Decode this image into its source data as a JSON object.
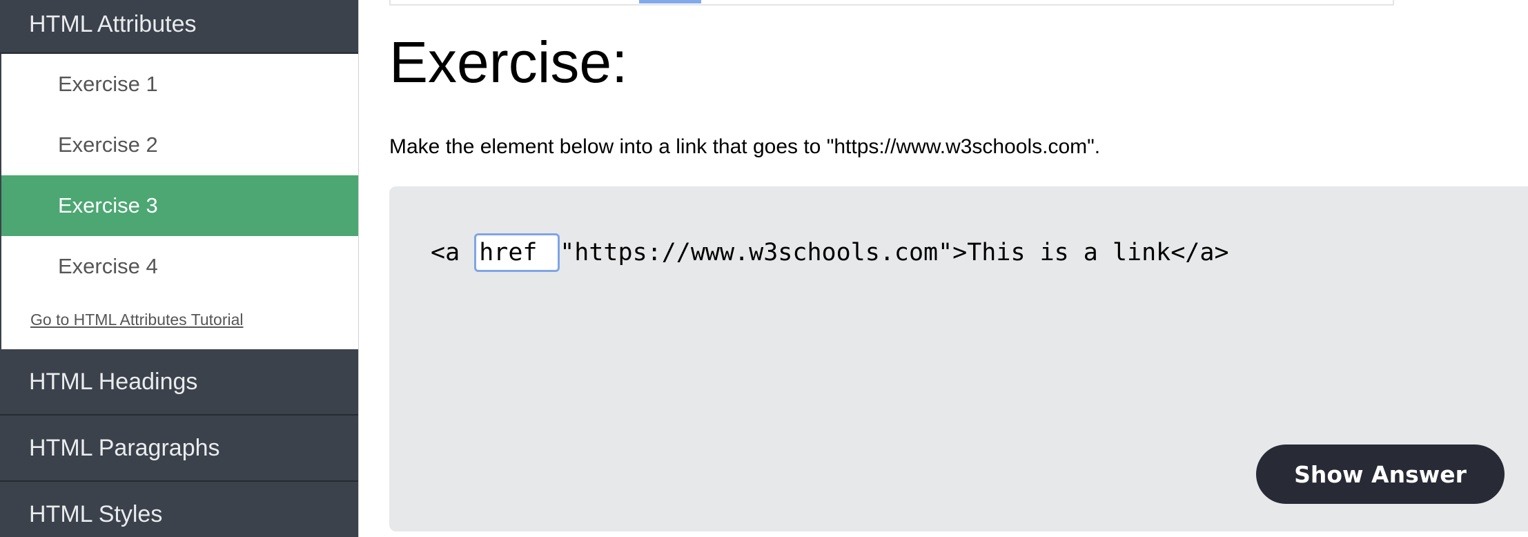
{
  "sidebar": {
    "section_title": "HTML Attributes",
    "items": [
      {
        "label": "Exercise 1",
        "active": false
      },
      {
        "label": "Exercise 2",
        "active": false
      },
      {
        "label": "Exercise 3",
        "active": true
      },
      {
        "label": "Exercise 4",
        "active": false
      }
    ],
    "tutorial_link": "Go to HTML Attributes Tutorial",
    "other_sections": [
      "HTML Headings",
      "HTML Paragraphs",
      "HTML Styles"
    ]
  },
  "main": {
    "title": "Exercise:",
    "instruction": "Make the element below into a link that goes to \"https://www.w3schools.com\".",
    "code": {
      "before": "<a ",
      "input_value": "href ",
      "after": "\"https://www.w3schools.com\">This is a link</a>"
    },
    "show_answer_label": "Show Answer"
  },
  "colors": {
    "sidebar_header": "#3b424b",
    "active_item": "#4ca772",
    "code_panel": "#e7e8ea",
    "button": "#282a35",
    "input_focus_border": "#7fa4e8"
  }
}
